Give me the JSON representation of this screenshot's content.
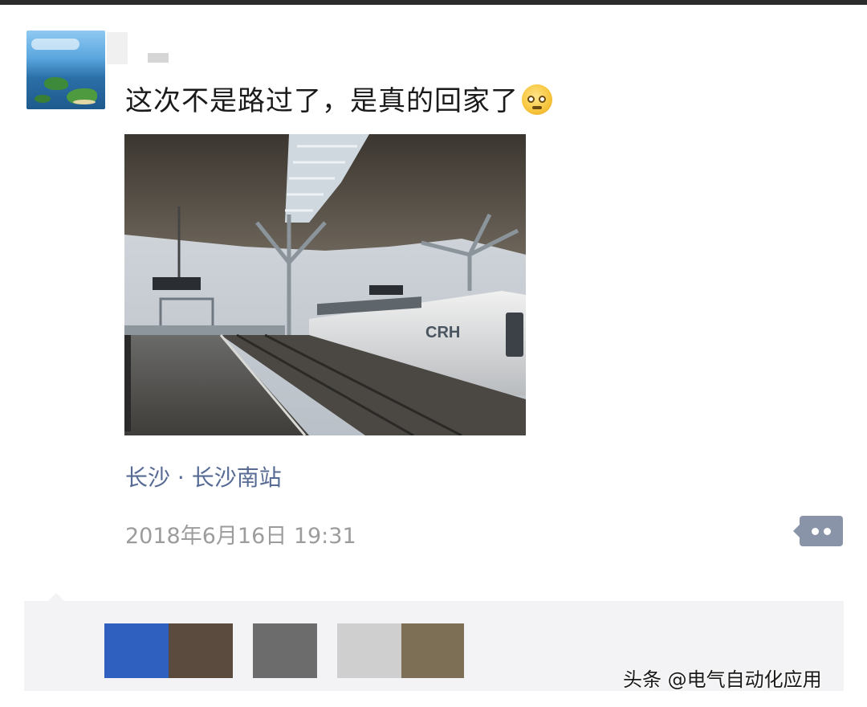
{
  "post": {
    "text": "这次不是路过了，是真的回家了",
    "emoji_icon": "flushed-face-emoji-icon",
    "photo_subject": "train-station-platform-photo",
    "photo_text": "CRH",
    "location": "长沙 · 长沙南站",
    "timestamp": "2018年6月16日 19:31"
  },
  "actions": {
    "comment_icon": "comment-more-icon"
  },
  "watermark": {
    "text": "头条 @电气自动化应用"
  },
  "colors": {
    "link": "#576b95",
    "meta": "#9c9c9c",
    "comment_button": "#8a94a8",
    "comment_bg": "#f3f3f5"
  }
}
